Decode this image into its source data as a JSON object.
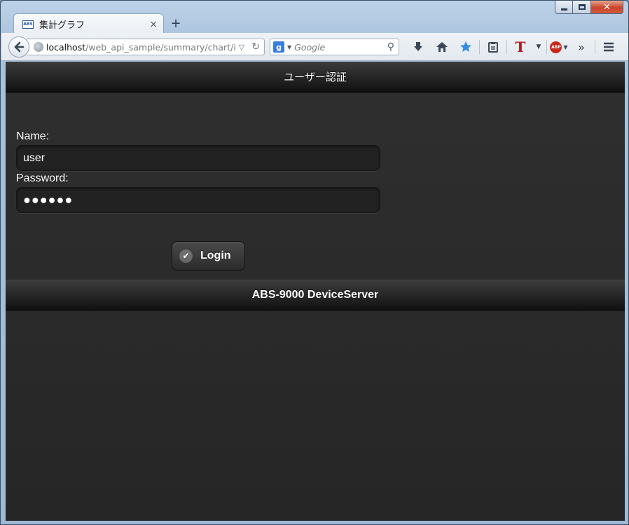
{
  "browser": {
    "tab": {
      "favicon_text": "ABS",
      "title": "集計グラフ",
      "close_glyph": "×"
    },
    "new_tab_glyph": "+",
    "window_controls": {
      "close_glyph": "✕"
    },
    "url": {
      "host": "localhost",
      "path": "/web_api_sample/summary/chart/inc"
    },
    "search": {
      "engine_letter": "g",
      "placeholder": "Google"
    },
    "toolbar": {
      "abp_label": "ABP",
      "t_label": "T"
    }
  },
  "page": {
    "header_title": "ユーザー認証",
    "form": {
      "name_label": "Name:",
      "name_value": "user",
      "password_label": "Password:",
      "password_value": "●●●●●●",
      "login_label": "Login"
    },
    "footer_title": "ABS-9000 DeviceServer"
  }
}
